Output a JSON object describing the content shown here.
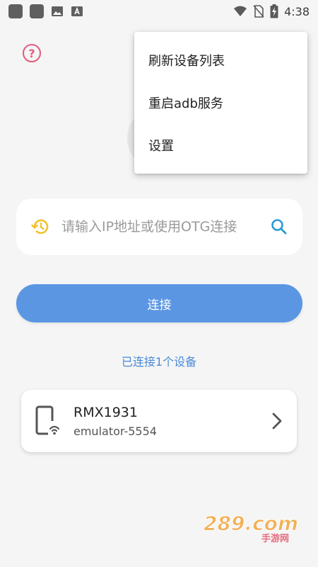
{
  "status_bar": {
    "time": "4:38",
    "icons": [
      "app-icon",
      "app-icon",
      "image-icon",
      "font-icon",
      "wifi-icon",
      "no-sim-icon",
      "battery-charging-icon"
    ]
  },
  "menu": {
    "items": [
      {
        "label": "刷新设备列表"
      },
      {
        "label": "重启adb服务"
      },
      {
        "label": "设置"
      }
    ]
  },
  "search": {
    "placeholder": "请输入IP地址或使用OTG连接"
  },
  "connect_button": {
    "label": "连接"
  },
  "connected_count": "已连接1个设备",
  "devices": [
    {
      "name": "RMX1931",
      "serial": "emulator-5554"
    }
  ],
  "watermark": {
    "text": "289.com",
    "subtext": "手游网"
  },
  "colors": {
    "accent_blue": "#5b96e2",
    "link_blue": "#4a8ad8",
    "help_pink": "#e25b7e",
    "history_yellow": "#f2c230",
    "search_blue": "#2a9ad8"
  }
}
